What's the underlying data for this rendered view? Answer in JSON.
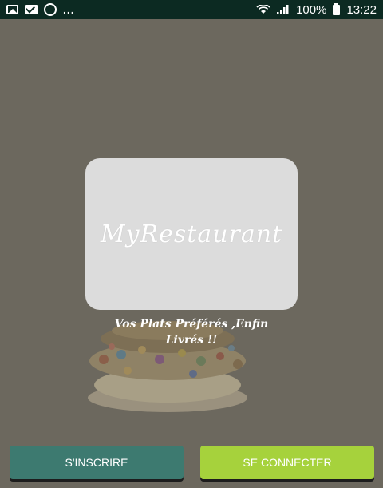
{
  "status_bar": {
    "left_icons": [
      "image-icon",
      "mail-icon",
      "whatsapp-icon",
      "more-dots-icon"
    ],
    "more_indicator": "...",
    "battery_percent": "100%",
    "time": "13:22"
  },
  "splash": {
    "logo_text": "MyRestaurant",
    "tagline_line1": "Vos Plats Préférés ,Enfin",
    "tagline_line2": "Livrés !!"
  },
  "actions": {
    "signup_label": "S'INSCRIRE",
    "login_label": "SE CONNECTER"
  },
  "colors": {
    "status_bar": "#0c2a22",
    "background_overlay": "#6c685e",
    "card": "#dcdcdc",
    "signup_button": "#3d7a70",
    "login_button": "#a6d23c"
  }
}
